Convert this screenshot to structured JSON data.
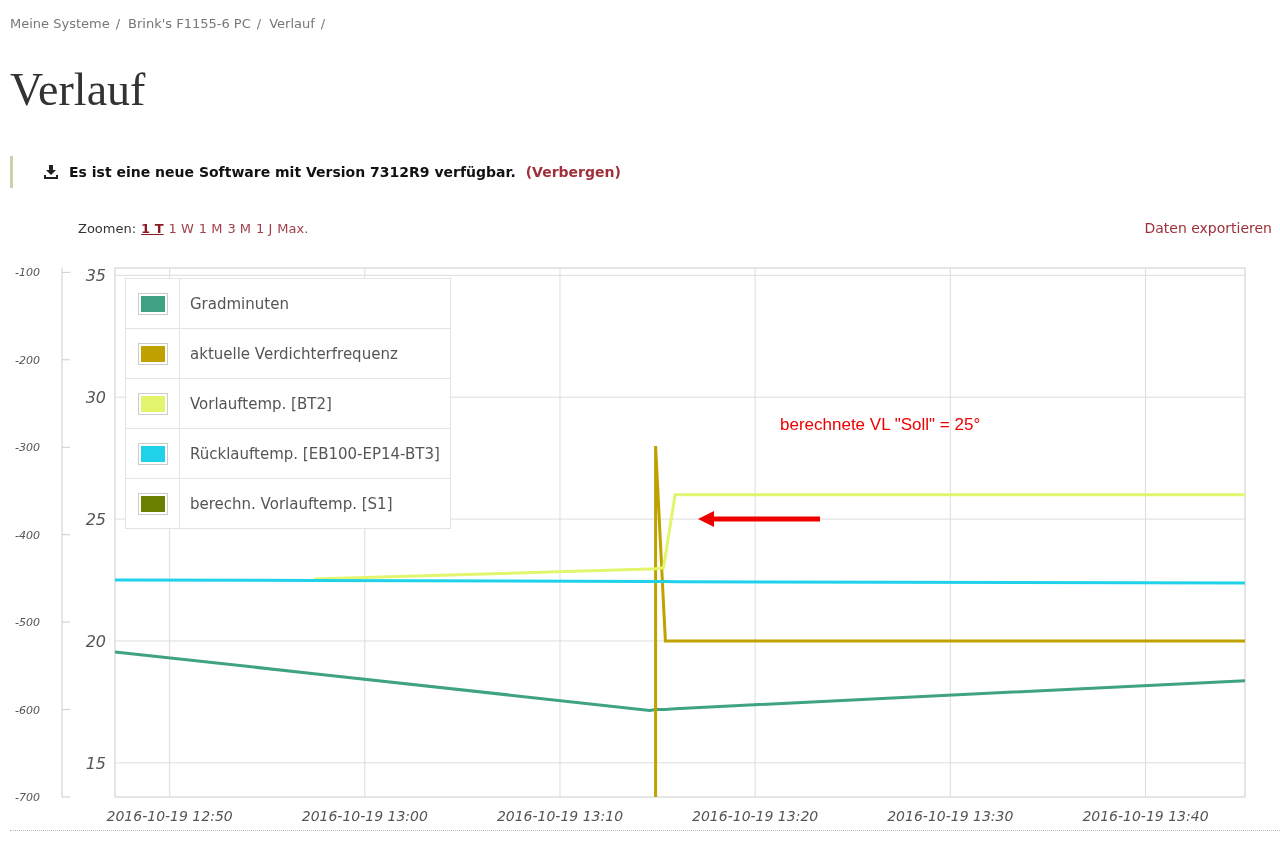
{
  "breadcrumb": [
    "Meine Systeme",
    "Brink's F1155-6 PC",
    "Verlauf"
  ],
  "breadcrumb_separator": "/",
  "title": "Verlauf",
  "notice": {
    "text": "Es ist eine neue Software mit Version 7312R9 verfügbar.",
    "link": "(Verbergen)"
  },
  "zoom": {
    "label": "Zoomen:",
    "options": [
      {
        "label": "1 T",
        "selected": true
      },
      {
        "label": "1 W",
        "selected": false
      },
      {
        "label": "1 M",
        "selected": false
      },
      {
        "label": "3 M",
        "selected": false
      },
      {
        "label": "1 J",
        "selected": false
      },
      {
        "label": "Max.",
        "selected": false
      }
    ]
  },
  "export_link": "Daten exportieren",
  "chart_data": {
    "type": "line",
    "x": [
      "2016-10-19 12:47:12",
      "2016-10-19 12:57:24",
      "2016-10-19 13:14:36",
      "2016-10-19 13:14:54",
      "2016-10-19 13:14:54",
      "2016-10-19 13:15:18",
      "2016-10-19 13:15:24",
      "2016-10-19 13:15:54",
      "2016-10-19 13:45:06"
    ],
    "xlim": [
      "2016-10-19 12:47:12",
      "2016-10-19 13:45:06"
    ],
    "xticks": [
      "2016-10-19 12:50",
      "2016-10-19 13:00",
      "2016-10-19 13:10",
      "2016-10-19 13:20",
      "2016-10-19 13:30",
      "2016-10-19 13:40"
    ],
    "grid": true,
    "legend": "top-left",
    "ylim": [
      13.6,
      35.3
    ],
    "yticks": [
      15,
      20,
      25,
      30,
      35
    ],
    "y2lim": [
      -700,
      -95
    ],
    "y2ticks": [
      -100,
      -200,
      -300,
      -400,
      -500,
      -600,
      -700
    ],
    "series": [
      {
        "name": "Gradminuten",
        "color": "#3fa282",
        "axis": "y2",
        "values": [
          -534,
          -559,
          -601,
          -600,
          -600,
          -600,
          -600,
          -599,
          -567
        ]
      },
      {
        "name": "aktuelle Verdichterfrequenz",
        "color": "#bfa200",
        "values": [
          null,
          null,
          null,
          13.6,
          28.0,
          21.6,
          20.0,
          20.0,
          20.0
        ]
      },
      {
        "name": "Vorlauftemp. [BT2]",
        "color": "#e2f56c",
        "values": [
          null,
          22.54,
          22.95,
          22.96,
          22.96,
          23.0,
          23.5,
          26.0,
          26.0
        ]
      },
      {
        "name": "Rücklauftemp. [EB100-EP14-BT3]",
        "color": "#1fd2ea",
        "values": [
          22.5,
          22.48,
          22.44,
          22.44,
          22.44,
          22.44,
          22.44,
          22.43,
          22.38
        ]
      },
      {
        "name": "berechn. Vorlauftemp. [S1]",
        "color": "#6b7f00",
        "values": [
          null,
          null,
          null,
          null,
          null,
          null,
          null,
          null,
          null
        ]
      }
    ],
    "annotations": [
      "berechnete VL \"Soll\" = 25°"
    ]
  }
}
